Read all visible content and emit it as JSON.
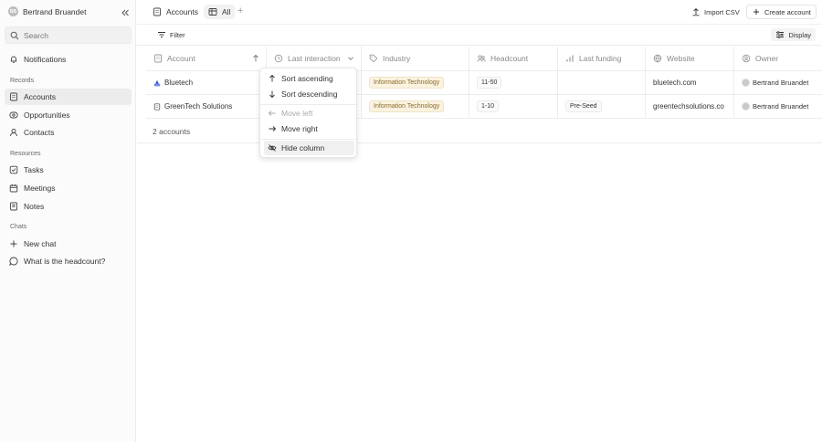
{
  "workspace": {
    "initials": "BB",
    "name": "Bertrand Bruandet"
  },
  "search": {
    "placeholder": "Search"
  },
  "nav": {
    "notifications": "Notifications",
    "records_label": "Records",
    "records": [
      "Accounts",
      "Opportunities",
      "Contacts"
    ],
    "resources_label": "Resources",
    "resources": [
      "Tasks",
      "Meetings",
      "Notes"
    ],
    "chats_label": "Chats",
    "chats": [
      "New chat",
      "What is the headcount?"
    ]
  },
  "topbar": {
    "tab_accounts": "Accounts",
    "tab_all": "All",
    "import_label": "Import CSV",
    "create_label": "Create account"
  },
  "viewbar": {
    "filter_label": "Filter",
    "display_label": "Display"
  },
  "table": {
    "columns": [
      "Account",
      "Last interaction",
      "Industry",
      "Headcount",
      "Last funding",
      "Website",
      "Owner"
    ],
    "rows": [
      {
        "account": "Bluetech",
        "industry": "Information Technology",
        "headcount": "11-50",
        "last_funding": "",
        "website": "bluetech.com",
        "owner": "Bertrand Bruandet"
      },
      {
        "account": "GreenTech Solutions",
        "industry": "Information Technology",
        "headcount": "1-10",
        "last_funding": "Pre-Seed",
        "website": "greentechsolutions.co",
        "owner": "Bertrand Bruandet"
      }
    ],
    "count_label": "2 accounts"
  },
  "menu": {
    "sort_asc": "Sort ascending",
    "sort_desc": "Sort descending",
    "move_left": "Move left",
    "move_right": "Move right",
    "hide_column": "Hide column"
  },
  "colors": {
    "tag_bg": "#fbf2df",
    "tag_text": "#8a6a2a",
    "accent_blue": "#3b5bdb"
  }
}
